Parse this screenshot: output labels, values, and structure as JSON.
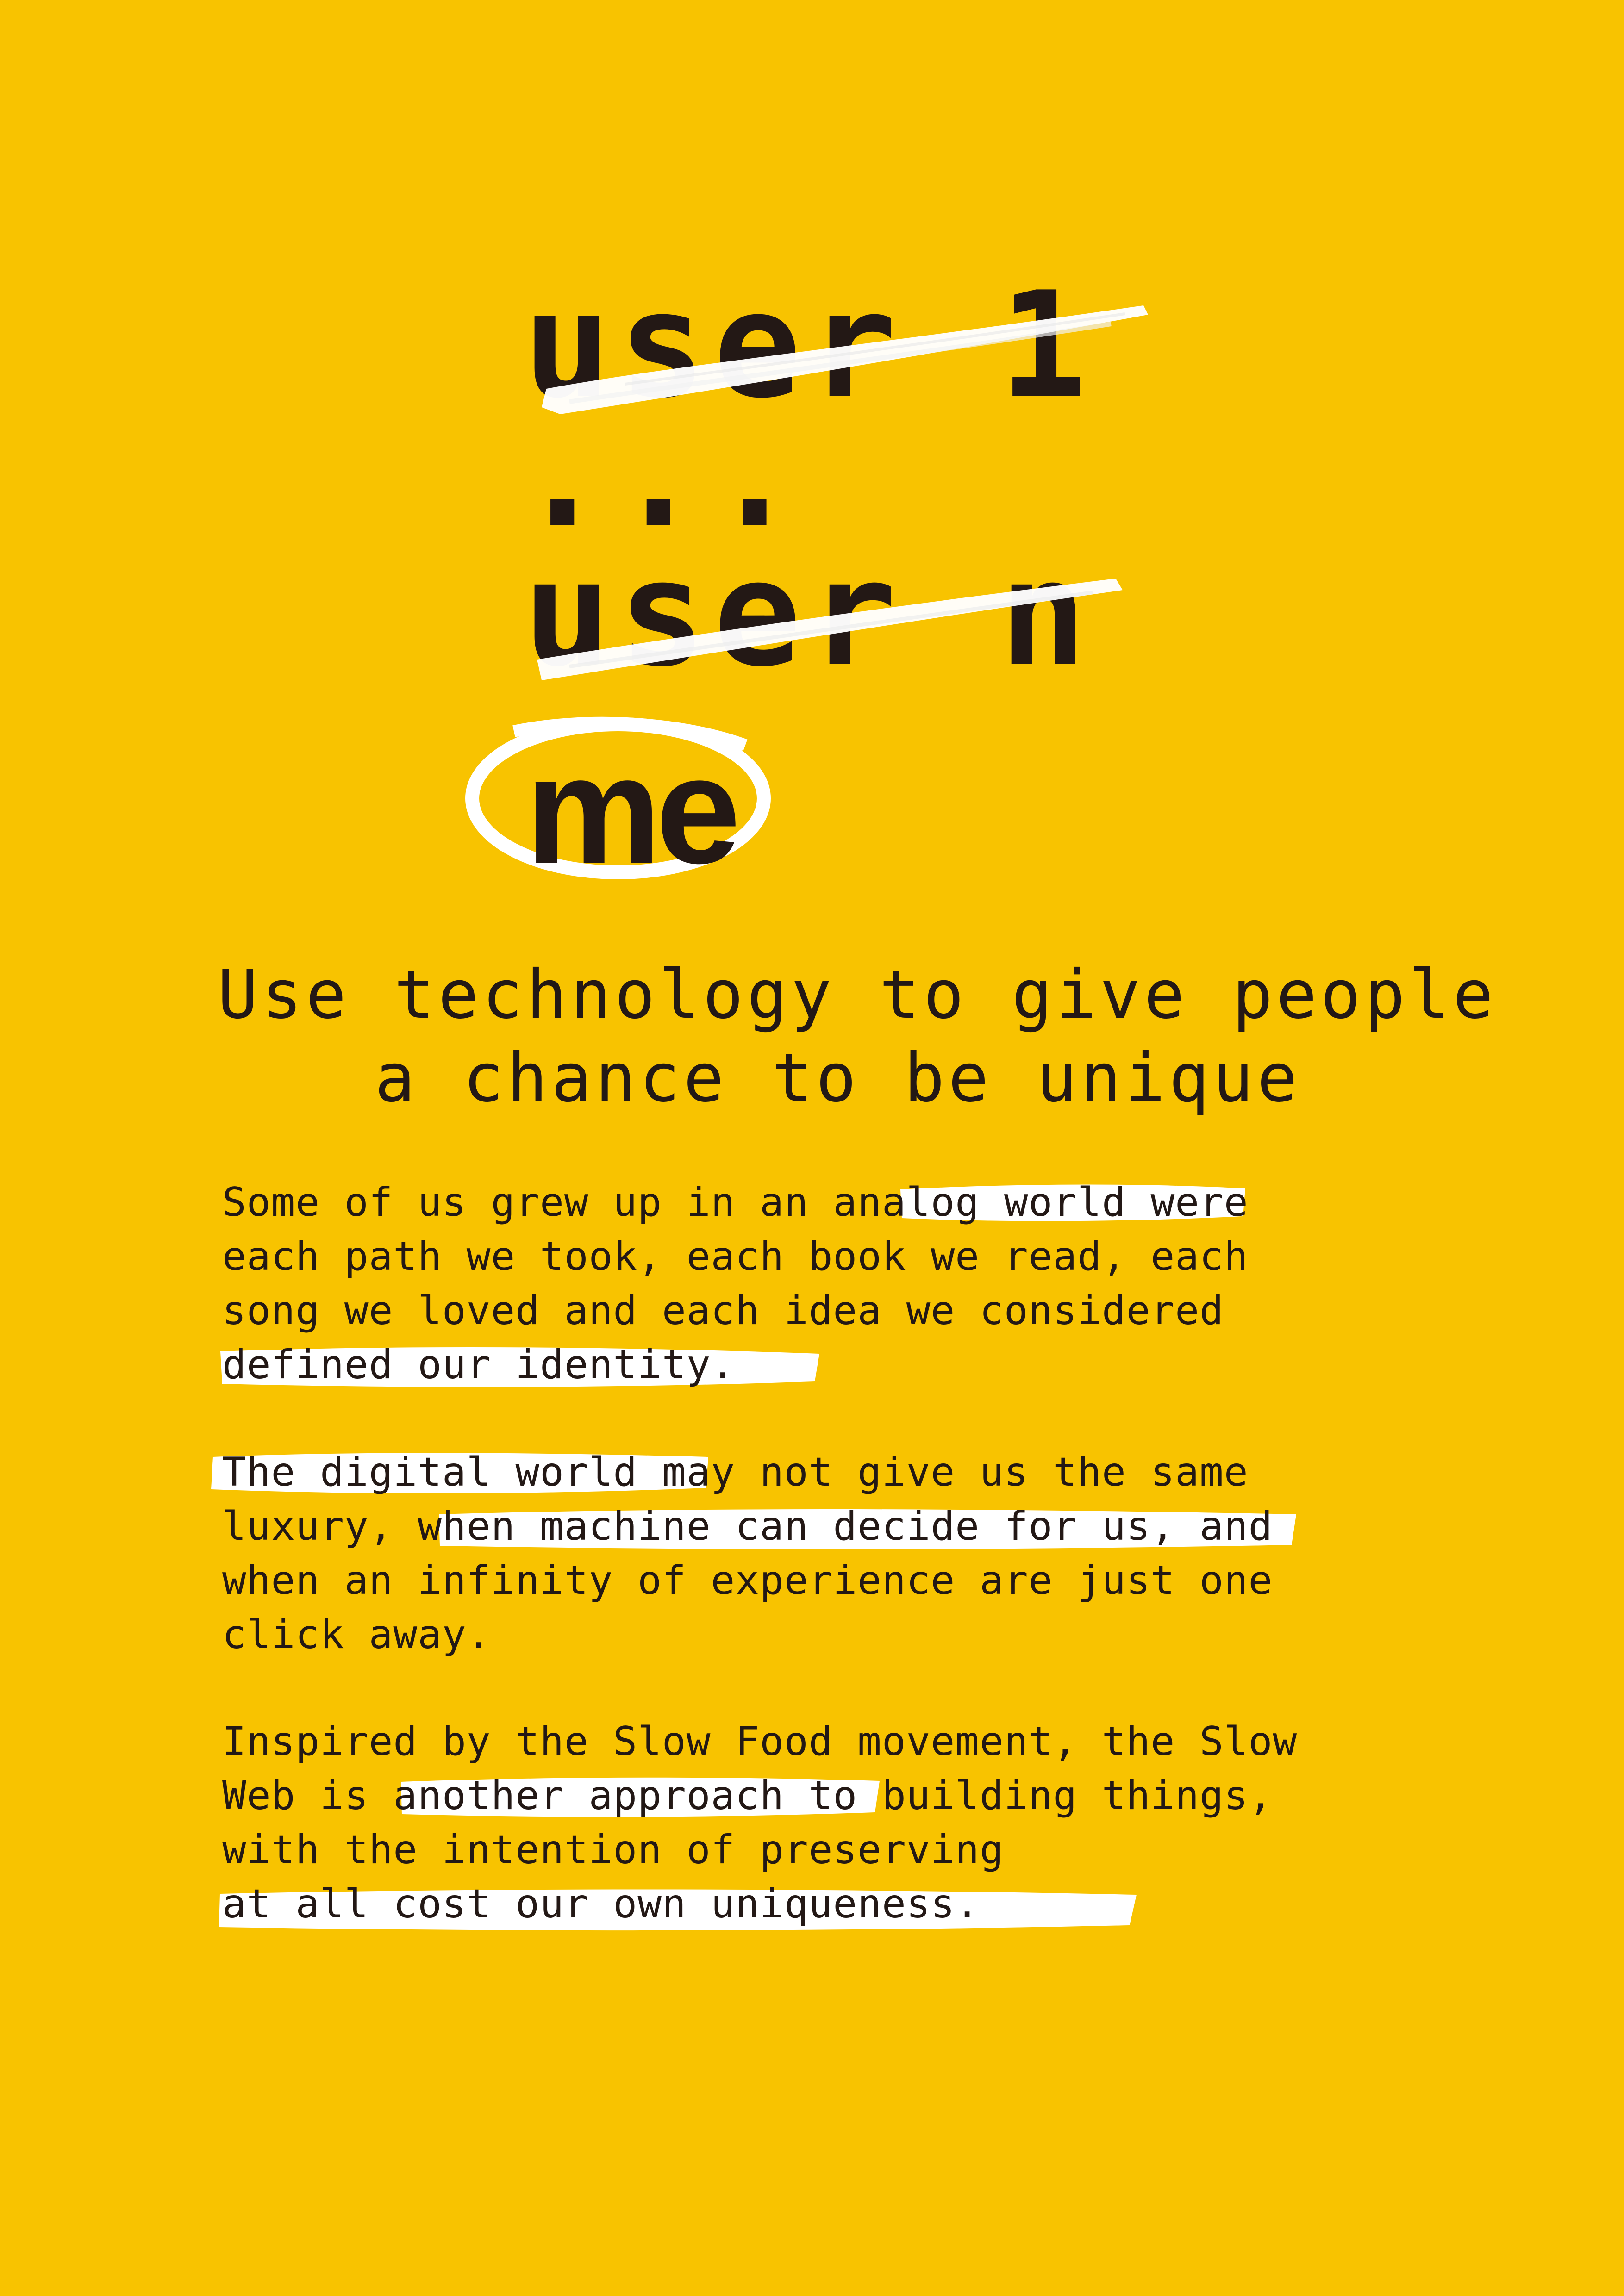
{
  "brand_color": "#F8C300",
  "ink_color": "#231815",
  "brush_color": "#FFFFFF",
  "hero": {
    "line1": "user 1",
    "line2": "...",
    "line3": "user n",
    "line4": "me"
  },
  "subtitle": {
    "line1": "Use technology to give people",
    "line2": "a chance to be unique"
  },
  "paragraphs": [
    {
      "lines": [
        "Some of us grew up in an analog world were",
        "each path we took, each book we read, each",
        "song we loved and each idea we considered",
        "defined our identity."
      ],
      "highlights": [
        "analog world",
        "defined our identity."
      ]
    },
    {
      "lines": [
        "The digital world may not give us the same",
        "luxury, when machine can decide for us, and",
        "when an infinity of experience are just one",
        "click away."
      ],
      "highlights": [
        "The digital world",
        "when machine can decide for us,"
      ]
    },
    {
      "lines": [
        "Inspired by the Slow Food movement, the Slow",
        "Web is another approach to building things,",
        "with the intention of preserving",
        "at all cost our own uniqueness."
      ],
      "highlights": [
        "another approach",
        "at all cost our own uniqueness."
      ]
    }
  ]
}
